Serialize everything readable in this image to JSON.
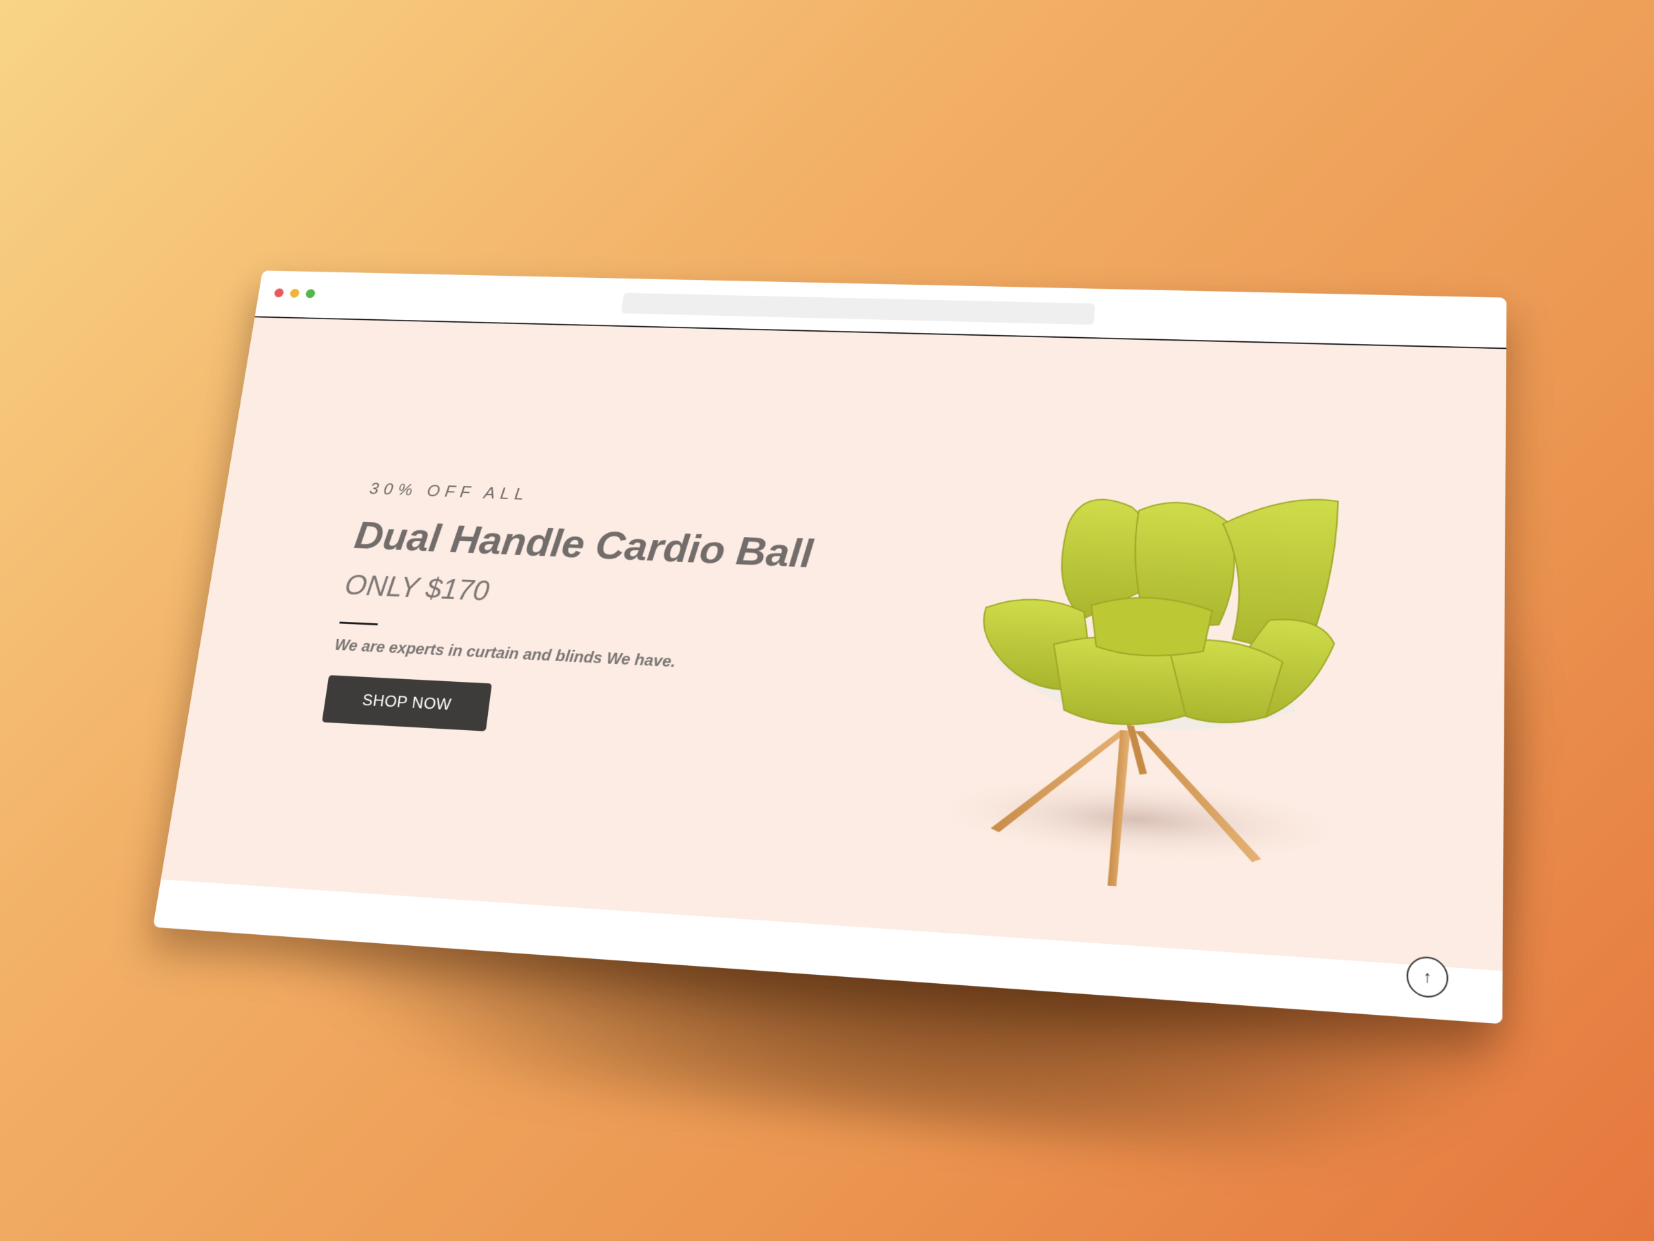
{
  "window": {
    "controls": [
      "close",
      "minimize",
      "maximize"
    ],
    "address_bar_value": ""
  },
  "hero": {
    "discount_label": "30% OFF ALL",
    "headline": "Dual Handle Cardio Ball",
    "price": "ONLY $170",
    "description": "We are experts in curtain and blinds We have.",
    "cta_label": "SHOP NOW",
    "product_image": "green-lounge-chair"
  },
  "scroll_top": {
    "icon": "arrow-up-icon",
    "glyph": "↑"
  },
  "colors": {
    "hero_background": "#fdece3",
    "button_background": "#3d3c3b",
    "heading_text": "#726d6b",
    "chair_green": "#c5d13c",
    "chair_legs": "#d9a15e"
  }
}
